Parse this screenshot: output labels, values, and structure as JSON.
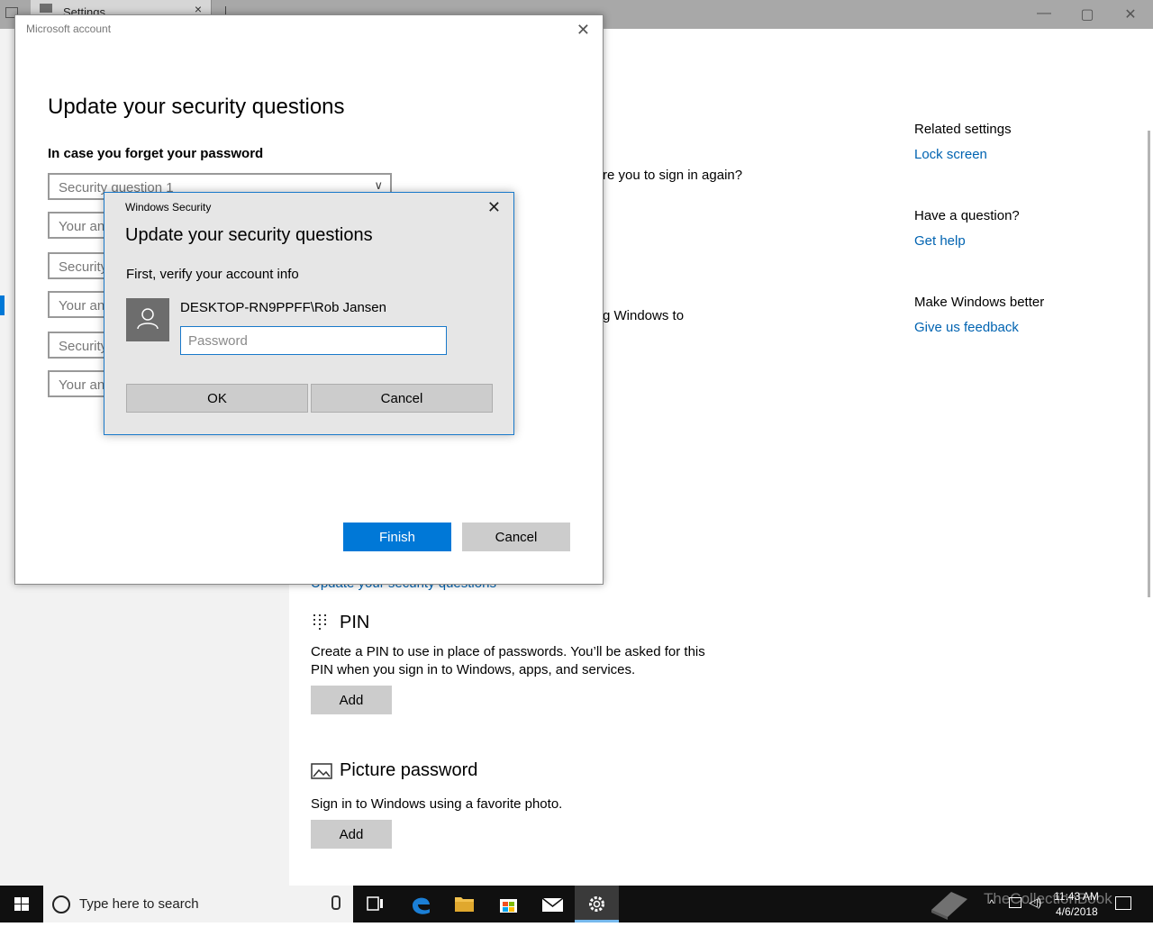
{
  "settings_window": {
    "tab_title": "Settings",
    "tab_close": "×",
    "controls": {
      "minimize": "—",
      "maximize": "▢",
      "close": "✕"
    },
    "fragments": {
      "sign_in_again": "re you to sign in again?",
      "windows_to": "g Windows to"
    },
    "related": {
      "related_settings_heading": "Related settings",
      "lock_screen_link": "Lock screen",
      "question_heading": "Have a question?",
      "get_help_link": "Get help",
      "better_heading": "Make Windows better",
      "feedback_link": "Give us feedback"
    },
    "update_security_link": "Update your security questions",
    "pin": {
      "title": "PIN",
      "description": "Create a PIN to use in place of passwords. You’ll be asked for this PIN when you sign in to Windows, apps, and services.",
      "add_label": "Add"
    },
    "picture_password": {
      "title": "Picture password",
      "description": "Sign in to Windows using a favorite photo.",
      "add_label": "Add"
    }
  },
  "ms_dialog": {
    "title": "Microsoft account",
    "close": "✕",
    "heading": "Update your security questions",
    "subheading": "In case you forget your password",
    "fields": [
      "Security question 1",
      "Your answer",
      "Security question 2",
      "Your answer",
      "Security question 3",
      "Your answer"
    ],
    "finish_label": "Finish",
    "cancel_label": "Cancel"
  },
  "ws_dialog": {
    "title": "Windows Security",
    "close": "✕",
    "heading": "Update your security questions",
    "verify_text": "First, verify your account info",
    "username": "DESKTOP-RN9PPFF\\Rob Jansen",
    "password_placeholder": "Password",
    "ok_label": "OK",
    "cancel_label": "Cancel"
  },
  "taskbar": {
    "search_placeholder": "Type here to search",
    "time": "11:43 AM",
    "date": "4/6/2018",
    "watermark": "TheCollectionBook"
  }
}
